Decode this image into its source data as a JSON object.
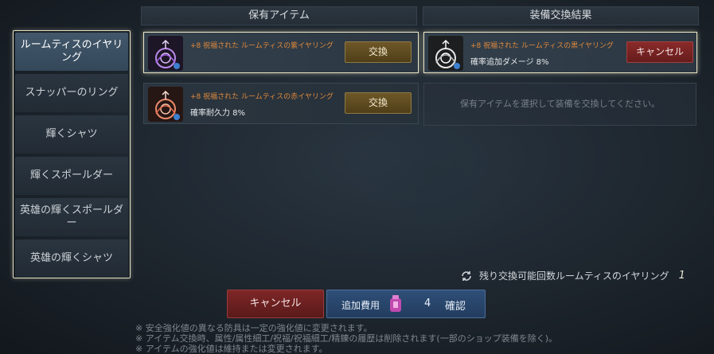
{
  "sidebar": {
    "items": [
      {
        "label": "ルームティスのイヤリング",
        "active": true
      },
      {
        "label": "スナッパーのリング"
      },
      {
        "label": "輝くシャツ"
      },
      {
        "label": "輝くスポールダー"
      },
      {
        "label": "英雄の輝くスポールダー"
      },
      {
        "label": "英雄の輝くシャツ"
      }
    ]
  },
  "owned": {
    "title": "保有アイテム",
    "items": [
      {
        "name": "+8 祝福された ルームティスの紫イヤリング",
        "stat": "",
        "button": "交換",
        "gem_color": "#a060e0"
      },
      {
        "name": "+8 祝福された ルームティスの赤イヤリング",
        "stat": "確率耐久力 8%",
        "button": "交換",
        "gem_color": "#e06a48"
      }
    ]
  },
  "result": {
    "title": "装備交換結果",
    "item": {
      "name": "+8 祝福された ルームティスの黒イヤリング",
      "stat": "確率追加ダメージ 8%",
      "button": "キャンセル",
      "gem_color": "#d9d9d9"
    },
    "empty_text": "保有アイテムを選択して装備を交換してください。"
  },
  "remaining": {
    "label": "残り交換可能回数ルームティスのイヤリング",
    "count": "1"
  },
  "footer": {
    "cancel": "キャンセル",
    "cost_label": "追加費用",
    "cost_value": "4",
    "confirm": "確認"
  },
  "notes": [
    "※ 安全強化値の異なる防具は一定の強化値に変更されます。",
    "※ アイテム交換時、属性/属性細工/祝福/祝福細工/精錬の履歴は削除されます(一部のショップ装備を除く)。",
    "※ アイテムの強化値は維持または変更されます。"
  ],
  "colors": {
    "accent_gold": "#e08a3c",
    "cancel_red": "#7e2626",
    "confirm_blue": "#2f4f78"
  }
}
